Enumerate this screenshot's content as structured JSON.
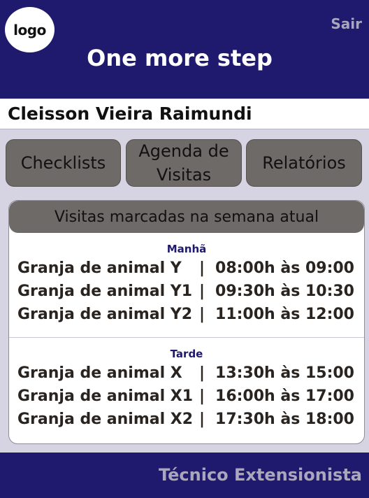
{
  "header": {
    "logo_text": "logo",
    "logout_label": "Sair",
    "title": "One more step"
  },
  "user": {
    "name": "Cleisson Vieira Raimundi"
  },
  "nav": {
    "buttons": [
      {
        "label": "Checklists"
      },
      {
        "label": "Agenda de Visitas"
      },
      {
        "label": "Relatórios"
      }
    ]
  },
  "visits": {
    "title": "Visitas marcadas na semana atual",
    "morning": {
      "label": "Manhã",
      "items": [
        {
          "farm": "Granja de animal Y",
          "time": "08:00h às 09:00"
        },
        {
          "farm": "Granja de animal Y1",
          "time": "09:30h às 10:30"
        },
        {
          "farm": "Granja de animal Y2",
          "time": "11:00h às 12:00"
        }
      ]
    },
    "afternoon": {
      "label": "Tarde",
      "items": [
        {
          "farm": "Granja de animal X",
          "time": "13:30h às 15:00"
        },
        {
          "farm": "Granja de animal X1",
          "time": "16:00h às 17:00"
        },
        {
          "farm": "Granja de animal X2",
          "time": "17:30h às 18:00"
        }
      ]
    },
    "separator": "|"
  },
  "footer": {
    "role": "Técnico Extensionista"
  },
  "colors": {
    "brand_navy": "#1f1a6e",
    "button_gray": "#6e6a68",
    "background": "#d6d3e3"
  }
}
